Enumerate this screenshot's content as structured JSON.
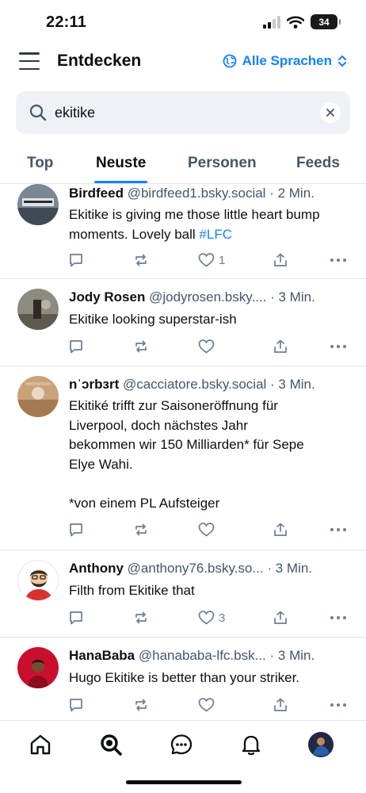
{
  "status_bar": {
    "time": "22:11",
    "battery": "34"
  },
  "header": {
    "title": "Entdecken",
    "language_label": "Alle Sprachen"
  },
  "search": {
    "value": "ekitike",
    "placeholder": ""
  },
  "tabs": [
    {
      "label": "Top"
    },
    {
      "label": "Neuste",
      "active": true
    },
    {
      "label": "Personen"
    },
    {
      "label": "Feeds"
    }
  ],
  "posts": [
    {
      "name": "Birdfeed",
      "handle": "@birdfeed1.bsky.social",
      "time": "· 2 Min.",
      "text": "Ekitike is giving me those little heart bump moments. Lovely ball ",
      "hashtag": "#LFC",
      "likes": "1"
    },
    {
      "name": "Jody Rosen",
      "handle": "@jodyrosen.bsky....",
      "time": "· 3 Min.",
      "text": "Ekitike looking superstar-ish",
      "likes": ""
    },
    {
      "name": "nˈɔrbɜrt",
      "handle": "@cacciatore.bsky.social",
      "time": "· 3 Min.",
      "text_lines": [
        "Ekitiké trifft zur Saisoneröffnung für",
        "Liverpool, doch nächstes Jahr",
        "bekommen wir 150 Milliarden* für Sepe",
        "Elye Wahi.",
        "",
        "*von einem PL Aufsteiger"
      ],
      "likes": ""
    },
    {
      "name": "Anthony",
      "handle": "@anthony76.bsky.so...",
      "time": "· 3 Min.",
      "text": "Filth from Ekitike that",
      "likes": "3"
    },
    {
      "name": "HanaBaba",
      "handle": "@hanababa-lfc.bsk...",
      "time": "· 3 Min.",
      "text": "Hugo Ekitike is better than your striker.",
      "likes": ""
    }
  ],
  "icons": {
    "menu": "menu-icon",
    "language": "globe-icon",
    "dropdown": "chevron-updown-icon",
    "search": "search-icon",
    "clear": "close-icon",
    "reply": "reply-icon",
    "repost": "repost-icon",
    "like": "heart-icon",
    "share": "share-icon",
    "more": "more-icon",
    "nav": [
      "home-icon",
      "search-icon",
      "chat-icon",
      "bell-icon",
      "profile-avatar"
    ]
  },
  "colors": {
    "accent": "#1083fe",
    "text": "#0b0f14",
    "muted": "#42576c",
    "search_bg": "#eef2f6"
  }
}
